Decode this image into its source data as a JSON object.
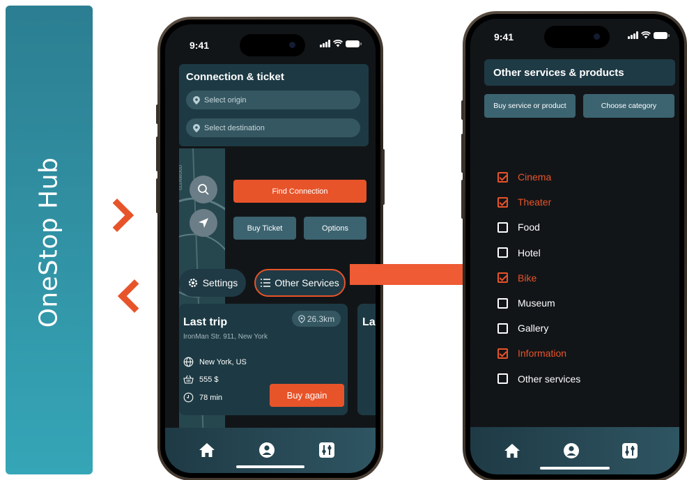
{
  "brand": {
    "title": "OneStop Hub"
  },
  "status_bar": {
    "time": "9:41"
  },
  "connection": {
    "title": "Connection & ticket",
    "origin_placeholder": "Select origin",
    "destination_placeholder": "Select destination",
    "find_label": "Find Connection",
    "buy_ticket_label": "Buy Ticket",
    "options_label": "Options"
  },
  "quick_actions": {
    "settings_label": "Settings",
    "other_services_label": "Other Services"
  },
  "last_trip": {
    "title": "Last trip",
    "peek_title": "La",
    "address": "IronMan Str. 911, New York",
    "distance": "26.3km",
    "location": "New York, US",
    "price": "555 $",
    "duration": "78 min",
    "buy_again_label": "Buy again"
  },
  "services": {
    "title": "Other services & products",
    "buy_label": "Buy service or product",
    "category_label": "Choose category",
    "categories": [
      {
        "label": "Cinema",
        "checked": true
      },
      {
        "label": "Theater",
        "checked": true
      },
      {
        "label": "Food",
        "checked": false
      },
      {
        "label": "Hotel",
        "checked": false
      },
      {
        "label": "Bike",
        "checked": true
      },
      {
        "label": "Museum",
        "checked": false
      },
      {
        "label": "Gallery",
        "checked": false
      },
      {
        "label": "Information",
        "checked": true
      },
      {
        "label": "Other services",
        "checked": false
      }
    ]
  },
  "tabbar": {
    "icons": [
      "home-icon",
      "profile-icon",
      "settings-sliders-icon"
    ]
  },
  "colors": {
    "accent": "#e8542a",
    "teal": "#3c6370",
    "card": "#1d3a44",
    "banner": "#35a6b7"
  }
}
